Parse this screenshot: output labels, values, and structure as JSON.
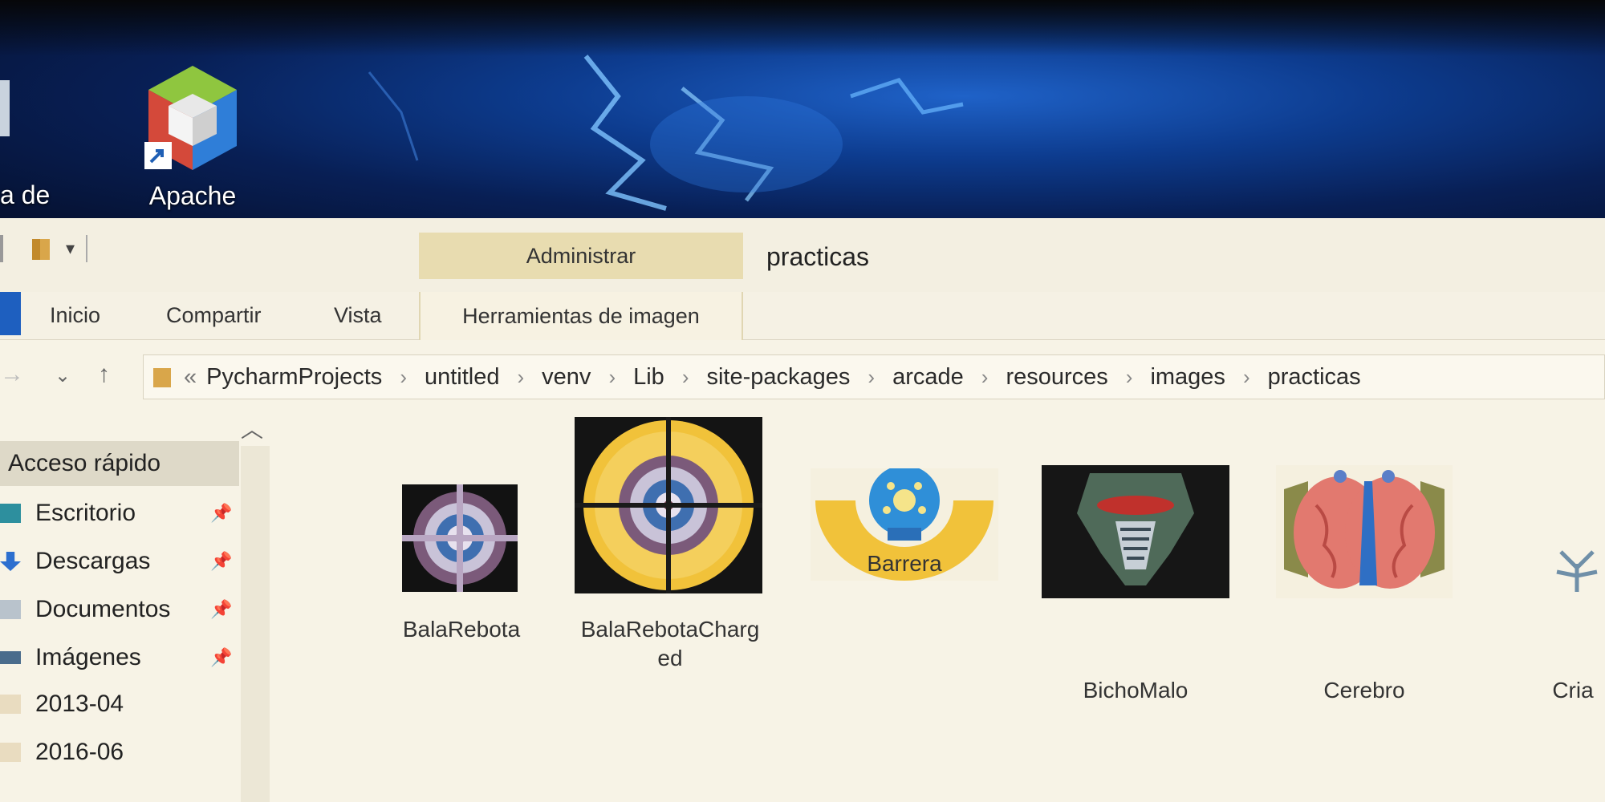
{
  "desktop": {
    "icons": [
      {
        "label": "a de"
      },
      {
        "label": "Apache"
      }
    ]
  },
  "window": {
    "title": "practicas",
    "context_tab_label": "Administrar",
    "ribbon_tabs": [
      "Inicio",
      "Compartir",
      "Vista"
    ],
    "context_subtab_label": "Herramientas de imagen",
    "breadcrumb_prefix": "«",
    "breadcrumb": [
      "PycharmProjects",
      "untitled",
      "venv",
      "Lib",
      "site-packages",
      "arcade",
      "resources",
      "images",
      "practicas"
    ],
    "colors": {
      "accent_file_tab": "#1e5fbf",
      "context_tab": "#e8dcb0"
    }
  },
  "navpane": {
    "quick_access": "Acceso rápido",
    "items": [
      {
        "label": "Escritorio",
        "icon": "desktop-icon"
      },
      {
        "label": "Descargas",
        "icon": "download-icon"
      },
      {
        "label": "Documentos",
        "icon": "documents-icon"
      },
      {
        "label": "Imágenes",
        "icon": "pictures-icon"
      },
      {
        "label": "2013-04",
        "icon": "folder-icon"
      },
      {
        "label": "2016-06",
        "icon": "folder-icon"
      }
    ]
  },
  "files": [
    {
      "name": "BalaRebota"
    },
    {
      "name": "BalaRebotaCharg"
    },
    {
      "name": "ed"
    },
    {
      "name": "Barrera"
    },
    {
      "name": "BichoMalo"
    },
    {
      "name": "Cerebro"
    },
    {
      "name": "Cria"
    }
  ]
}
